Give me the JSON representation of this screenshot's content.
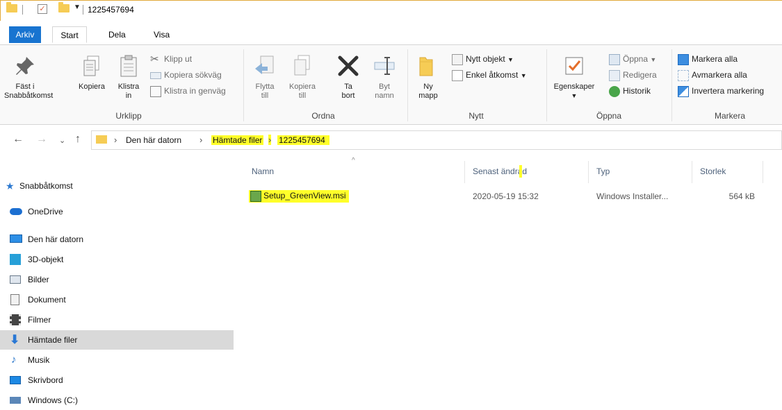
{
  "window": {
    "title": "1225457694"
  },
  "ribbon_tabs": [
    "Arkiv",
    "Start",
    "Dela",
    "Visa"
  ],
  "ribbon": {
    "urklipp": {
      "label": "Urklipp",
      "pin": "Fäst i\nSnabbåtkomst",
      "copy": "Kopiera",
      "paste": "Klistra\nin",
      "cut": "Klipp ut",
      "copy_path": "Kopiera sökväg",
      "paste_shortcut": "Klistra in genväg"
    },
    "ordna": {
      "label": "Ordna",
      "move_to": "Flytta\ntill",
      "copy_to": "Kopiera\ntill",
      "delete": "Ta\nbort",
      "rename": "Byt\nnamn"
    },
    "nytt": {
      "label": "Nytt",
      "new_folder": "Ny\nmapp",
      "new_item": "Nytt objekt",
      "easy_access": "Enkel åtkomst"
    },
    "oppna": {
      "label": "Öppna",
      "properties": "Egenskaper",
      "open": "Öppna",
      "edit": "Redigera",
      "history": "Historik"
    },
    "markera": {
      "label": "Markera",
      "select_all": "Markera alla",
      "select_none": "Avmarkera alla",
      "invert": "Invertera markering"
    }
  },
  "address": {
    "crumbs": [
      "Den här datorn",
      "Hämtade filer",
      "1225457694"
    ]
  },
  "nav": [
    {
      "label": "Snabbåtkomst",
      "icon": "star-icon"
    },
    {
      "label": "OneDrive",
      "icon": "cloud-icon"
    },
    {
      "label": "Den här datorn",
      "icon": "computer-icon"
    },
    {
      "label": "3D-objekt",
      "icon": "cube-icon"
    },
    {
      "label": "Bilder",
      "icon": "pictures-icon"
    },
    {
      "label": "Dokument",
      "icon": "document-icon"
    },
    {
      "label": "Filmer",
      "icon": "film-icon"
    },
    {
      "label": "Hämtade filer",
      "icon": "download-icon"
    },
    {
      "label": "Musik",
      "icon": "music-icon"
    },
    {
      "label": "Skrivbord",
      "icon": "desktop-icon"
    },
    {
      "label": "Windows (C:)",
      "icon": "drive-icon"
    }
  ],
  "columns": [
    "Namn",
    "Senast ändrad",
    "Typ",
    "Storlek"
  ],
  "files": [
    {
      "name": "Setup_GreenView.msi",
      "modified": "2020-05-19 15:32",
      "type": "Windows Installer...",
      "size": "564 kB"
    }
  ],
  "colors": {
    "accent": "#1874d0",
    "highlight": "#ffff2a",
    "selected_nav": "#d9d9d9"
  }
}
